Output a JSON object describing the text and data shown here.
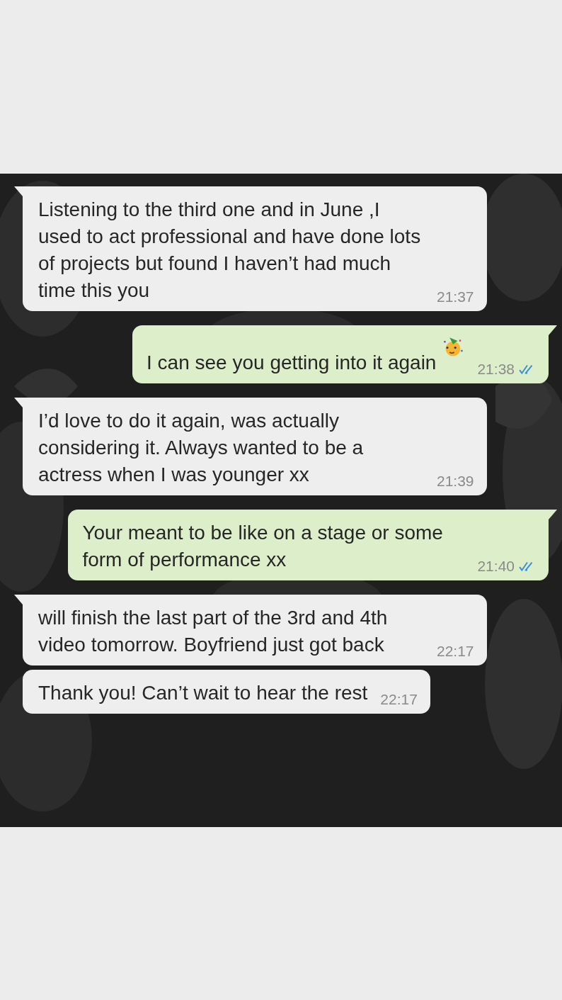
{
  "messages": [
    {
      "kind": "incoming",
      "tail": true,
      "text": "Listening to the third one and in June  ,I used to act professional and have done lots of projects but found I haven’t had much time this you",
      "time": "21:37"
    },
    {
      "kind": "outgoing",
      "tail": true,
      "text": "I can see you getting into it again",
      "emoji": true,
      "time": "21:38",
      "read": true
    },
    {
      "kind": "incoming",
      "tail": true,
      "text": "I’d love to do it again, was actually considering it. Always wanted to be a actress when I was younger xx",
      "time": "21:39"
    },
    {
      "kind": "outgoing",
      "tail": true,
      "text": "Your meant to be like on a stage or some form of performance xx",
      "time": "21:40",
      "read": true
    },
    {
      "kind": "incoming",
      "tail": true,
      "text": "will finish the last part of the 3rd and  4th video tomorrow. Boyfriend just got back",
      "time": "22:17"
    },
    {
      "kind": "incoming",
      "tail": false,
      "text": "Thank you! Can’t wait to hear the rest",
      "time": "22:17"
    }
  ]
}
